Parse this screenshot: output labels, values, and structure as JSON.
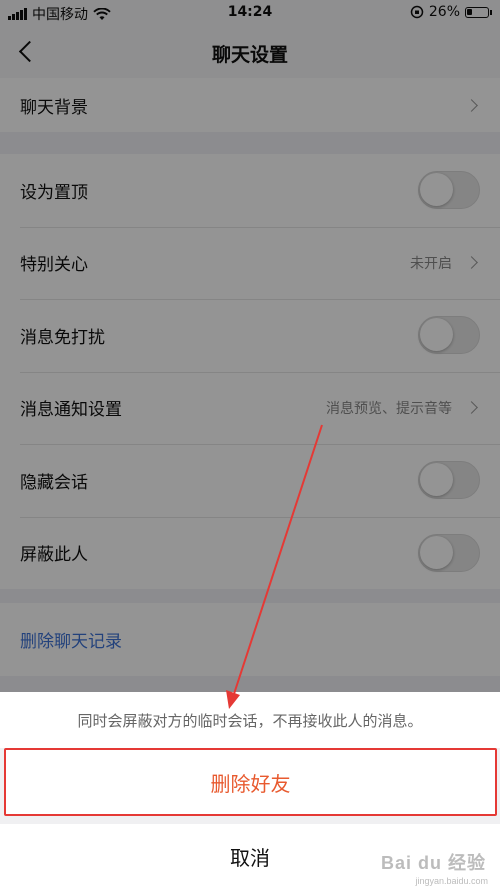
{
  "status_bar": {
    "carrier": "中国移动",
    "time": "14:24",
    "battery": "26%"
  },
  "nav": {
    "title": "聊天设置"
  },
  "settings": {
    "background": {
      "label": "聊天背景"
    },
    "pin": {
      "label": "设为置顶",
      "on": false
    },
    "special_care": {
      "label": "特别关心",
      "value": "未开启"
    },
    "dnd": {
      "label": "消息免打扰",
      "on": false
    },
    "notification": {
      "label": "消息通知设置",
      "value": "消息预览、提示音等"
    },
    "hide_chat": {
      "label": "隐藏会话",
      "on": false
    },
    "block": {
      "label": "屏蔽此人",
      "on": false
    },
    "delete_history": {
      "label": "删除聊天记录"
    }
  },
  "action_sheet": {
    "description": "同时会屏蔽对方的临时会话，不再接收此人的消息。",
    "delete_label": "删除好友",
    "cancel_label": "取消"
  },
  "colors": {
    "delete_text": "#e85a2f",
    "annotation": "#e53935",
    "link": "#3d72d6"
  },
  "watermark": {
    "brand": "Bai du 经验",
    "url": "jingyan.baidu.com"
  }
}
